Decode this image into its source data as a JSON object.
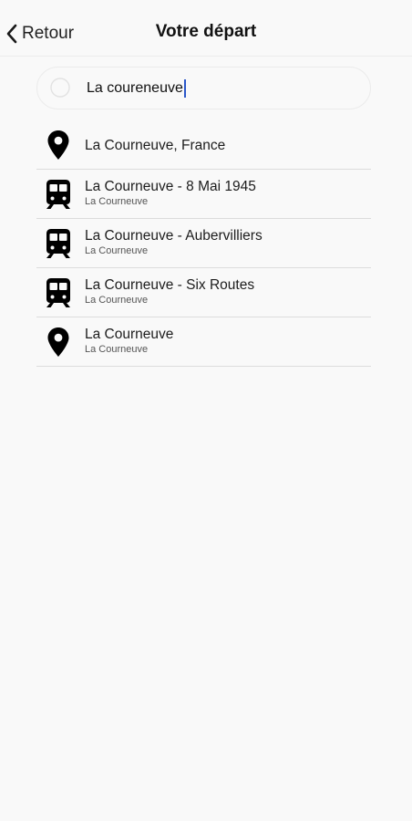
{
  "header": {
    "back_label": "Retour",
    "title": "Votre départ"
  },
  "search": {
    "value": "La coureneuve"
  },
  "results": [
    {
      "icon": "location-pin-icon",
      "title": "La Courneuve, France",
      "subtitle": ""
    },
    {
      "icon": "train-icon",
      "title": "La Courneuve - 8 Mai 1945",
      "subtitle": "La Courneuve"
    },
    {
      "icon": "train-icon",
      "title": "La Courneuve - Aubervilliers",
      "subtitle": "La Courneuve"
    },
    {
      "icon": "train-icon",
      "title": "La Courneuve - Six Routes",
      "subtitle": "La Courneuve"
    },
    {
      "icon": "location-pin-icon",
      "title": "La Courneuve",
      "subtitle": "La Courneuve"
    }
  ],
  "colors": {
    "caret": "#2b57c9",
    "background": "#f9f9f9",
    "divider": "#dcdcdc"
  }
}
